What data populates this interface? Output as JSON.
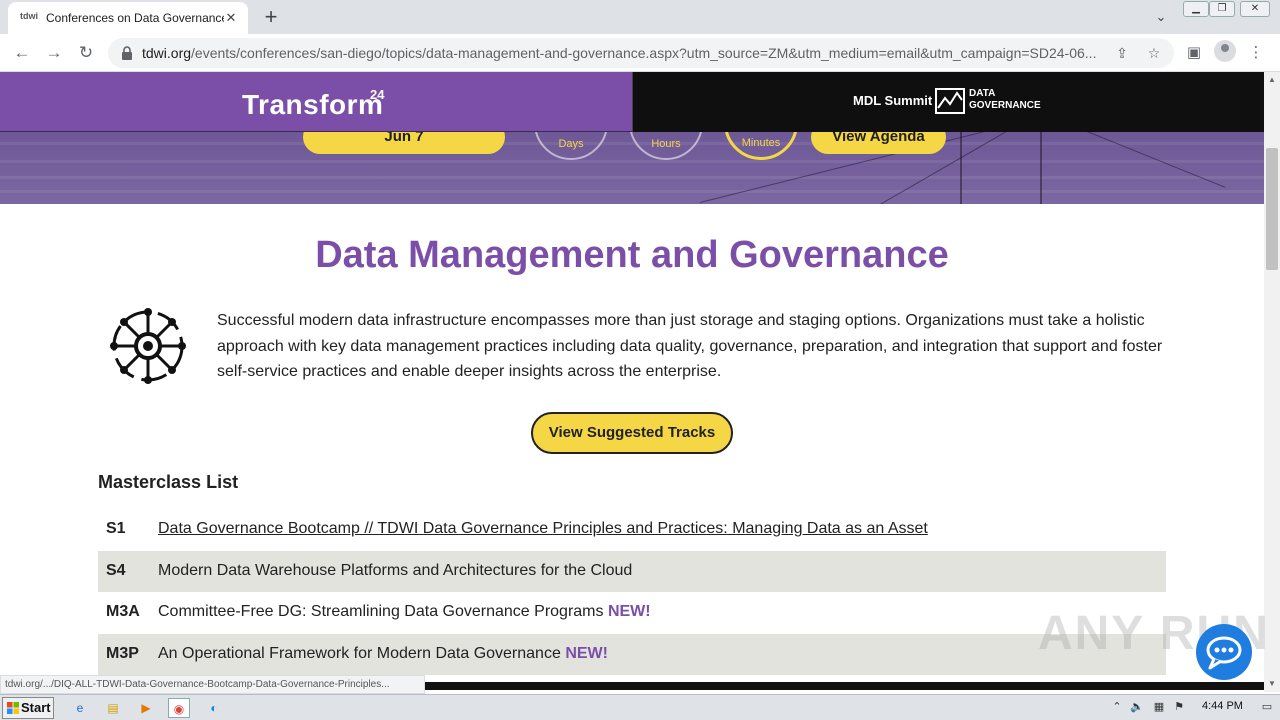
{
  "browser": {
    "tab_title": "Conferences on Data Governance &",
    "tab_favicon": "tdwi",
    "url_host": "tdwi.org",
    "url_path": "/events/conferences/san-diego/topics/data-management-and-governance.aspx?utm_source=ZM&utm_medium=email&utm_campaign=SD24-06..."
  },
  "hero": {
    "date_pill": "Jun 7",
    "countdown": [
      {
        "label": "Days"
      },
      {
        "label": "Hours"
      },
      {
        "label": "Minutes"
      }
    ],
    "agenda_button": "View Agenda"
  },
  "banner": {
    "transform_logo": "Transform",
    "transform_sup": "24",
    "mdl_summit": "MDL Summit",
    "dg_line1": "DATA",
    "dg_line2": "GOVERNANCE"
  },
  "page": {
    "title": "Data Management and Governance",
    "intro": "Successful modern data infrastructure encompasses more than just storage and staging options. Organizations must take a holistic approach with key data management practices including data quality, governance, preparation, and integration that support and foster self-service practices and enable deeper insights across the enterprise.",
    "tracks_button": "View Suggested Tracks",
    "masterclass_title": "Masterclass List",
    "masterclasses": [
      {
        "code": "S1",
        "title": "Data Governance Bootcamp // TDWI Data Governance Principles and Practices: Managing Data as an Asset",
        "badge": ""
      },
      {
        "code": "S4",
        "title": "Modern Data Warehouse Platforms and Architectures for the Cloud",
        "badge": ""
      },
      {
        "code": "M3A",
        "title": "Committee-Free DG: Streamlining Data Governance Programs",
        "badge": "NEW!"
      },
      {
        "code": "M3P",
        "title": "An Operational Framework for Modern Data Governance",
        "badge": "NEW!"
      }
    ]
  },
  "status_url": "tdwi.org/.../DIQ-ALL-TDWI-Data-Governance-Bootcamp-Data-Governance-Principles...",
  "watermark": "ANY RUN",
  "taskbar": {
    "start": "Start",
    "clock": "4:44 PM"
  },
  "colors": {
    "brand_purple": "#7b4fa8",
    "accent_yellow": "#f5d745"
  }
}
